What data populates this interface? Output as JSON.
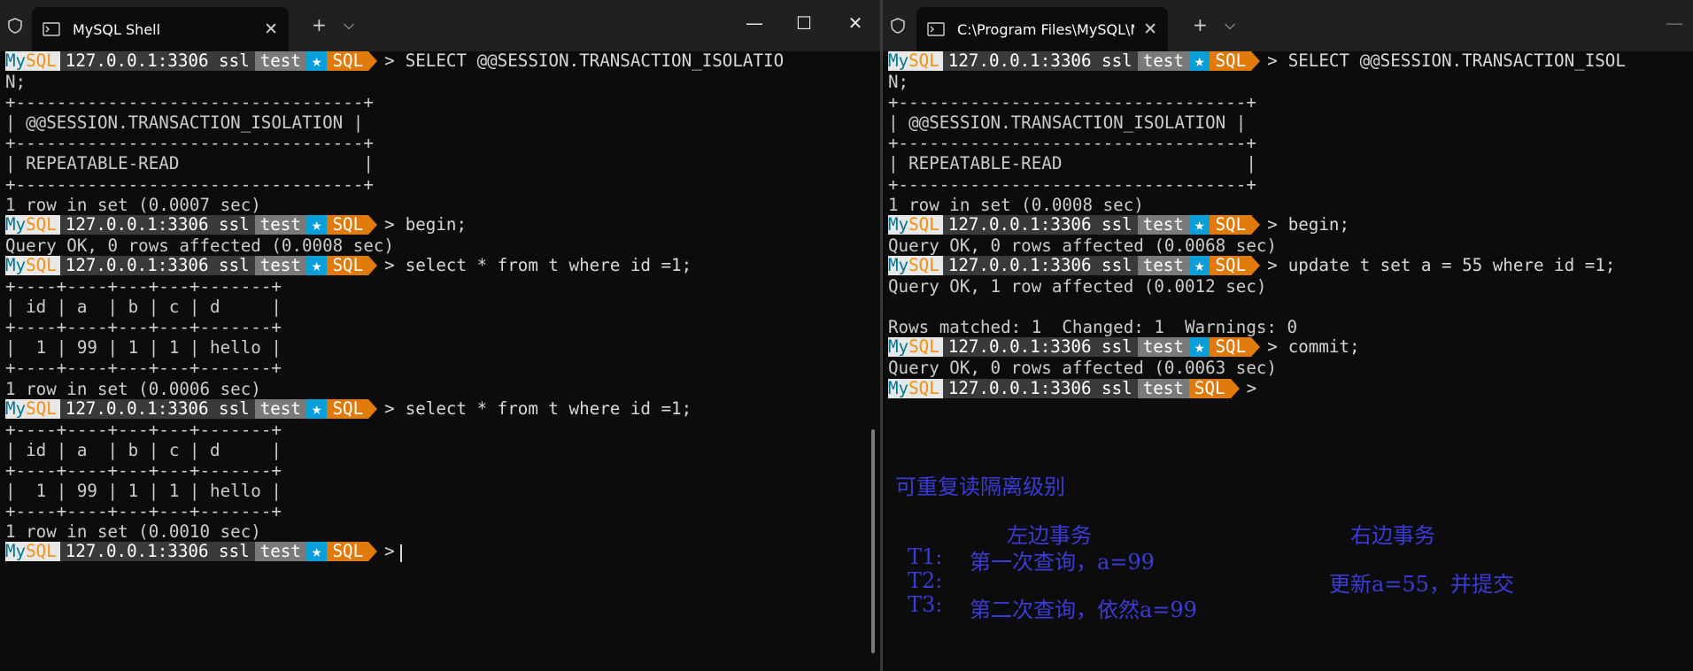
{
  "left": {
    "tab_title": "MySQL Shell",
    "lines": [
      {
        "type": "prompt",
        "mode": "SQL",
        "cmd": "SELECT @@SESSION.TRANSACTION_ISOLATIO"
      },
      {
        "type": "text",
        "text": "N;"
      },
      {
        "type": "text",
        "text": "+----------------------------------+"
      },
      {
        "type": "text",
        "text": "| @@SESSION.TRANSACTION_ISOLATION |"
      },
      {
        "type": "text",
        "text": "+----------------------------------+"
      },
      {
        "type": "text",
        "text": "| REPEATABLE-READ                  |"
      },
      {
        "type": "text",
        "text": "+----------------------------------+"
      },
      {
        "type": "text",
        "text": "1 row in set (0.0007 sec)"
      },
      {
        "type": "prompt",
        "mode": "SQL",
        "cmd": "begin;"
      },
      {
        "type": "text",
        "text": "Query OK, 0 rows affected (0.0008 sec)"
      },
      {
        "type": "prompt",
        "mode": "SQL",
        "cmd": "select * from t where id =1;"
      },
      {
        "type": "text",
        "text": "+----+----+---+---+-------+"
      },
      {
        "type": "text",
        "text": "| id | a  | b | c | d     |"
      },
      {
        "type": "text",
        "text": "+----+----+---+---+-------+"
      },
      {
        "type": "text",
        "text": "|  1 | 99 | 1 | 1 | hello |"
      },
      {
        "type": "text",
        "text": "+----+----+---+---+-------+"
      },
      {
        "type": "text",
        "text": "1 row in set (0.0006 sec)"
      },
      {
        "type": "prompt",
        "mode": "SQL",
        "cmd": "select * from t where id =1;"
      },
      {
        "type": "text",
        "text": "+----+----+---+---+-------+"
      },
      {
        "type": "text",
        "text": "| id | a  | b | c | d     |"
      },
      {
        "type": "text",
        "text": "+----+----+---+---+-------+"
      },
      {
        "type": "text",
        "text": "|  1 | 99 | 1 | 1 | hello |"
      },
      {
        "type": "text",
        "text": "+----+----+---+---+-------+"
      },
      {
        "type": "text",
        "text": "1 row in set (0.0010 sec)"
      },
      {
        "type": "prompt",
        "mode": "SQL",
        "cmd": "",
        "cursor": true
      }
    ]
  },
  "right": {
    "tab_title": "C:\\Program Files\\MySQL\\MyS",
    "lines": [
      {
        "type": "prompt",
        "mode": "SQL",
        "cmd": "SELECT @@SESSION.TRANSACTION_ISOL"
      },
      {
        "type": "text",
        "text": "N;"
      },
      {
        "type": "text",
        "text": "+----------------------------------+"
      },
      {
        "type": "text",
        "text": "| @@SESSION.TRANSACTION_ISOLATION |"
      },
      {
        "type": "text",
        "text": "+----------------------------------+"
      },
      {
        "type": "text",
        "text": "| REPEATABLE-READ                  |"
      },
      {
        "type": "text",
        "text": "+----------------------------------+"
      },
      {
        "type": "text",
        "text": "1 row in set (0.0008 sec)"
      },
      {
        "type": "prompt",
        "mode": "SQL",
        "cmd": "begin;"
      },
      {
        "type": "text",
        "text": "Query OK, 0 rows affected (0.0068 sec)"
      },
      {
        "type": "prompt",
        "mode": "SQL",
        "cmd": "update t set a = 55 where id =1;"
      },
      {
        "type": "text",
        "text": "Query OK, 1 row affected (0.0012 sec)"
      },
      {
        "type": "text",
        "text": ""
      },
      {
        "type": "text",
        "text": "Rows matched: 1  Changed: 1  Warnings: 0"
      },
      {
        "type": "prompt",
        "mode": "SQL",
        "cmd": "commit;"
      },
      {
        "type": "text",
        "text": "Query OK, 0 rows affected (0.0063 sec)"
      },
      {
        "type": "prompt",
        "mode": "SQL",
        "cmd": "",
        "nostar": true
      }
    ]
  },
  "prompt": {
    "my": "My",
    "sql": "SQL",
    "host": "127.0.0.1:3306 ssl",
    "db": "test",
    "star": "★",
    "gt": ">"
  },
  "titlebar": {
    "new_tab": "+",
    "dropdown": "⌵",
    "close_tab": "✕"
  },
  "controls": {
    "minimize": "—",
    "maximize": "☐",
    "close": "✕"
  },
  "annotation": {
    "title": "可重复读隔离级别",
    "left_header": "左边事务",
    "right_header": "右边事务",
    "t1_label": "T1:",
    "t1_text": "第一次查询，a=99",
    "t2_label": "T2:",
    "t2_right": "更新a=55，并提交",
    "t3_label": "T3:",
    "t3_text": "第二次查询，依然a=99"
  },
  "colors": {
    "mysql_blue": "#00758f",
    "orange": "#e07a0b",
    "star_blue": "#0a9fd8",
    "annotation": "#3b3bd6"
  }
}
